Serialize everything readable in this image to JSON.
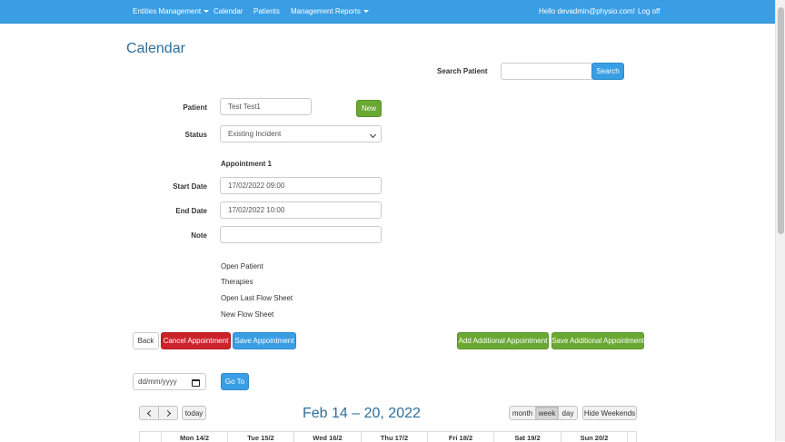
{
  "nav": {
    "entities": "Entities Management",
    "calendar": "Calendar",
    "patients": "Patients",
    "reports": "Management Reports",
    "greeting": "Hello devadmin@physio.com!",
    "logoff": "Log off"
  },
  "page": {
    "title": "Calendar"
  },
  "search": {
    "label": "Search Patient",
    "value": "",
    "button": "Search"
  },
  "form": {
    "patient_label": "Patient",
    "patient_value": "Test Test1",
    "new_button": "New",
    "status_label": "Status",
    "status_value": "Existing Incident",
    "appointment_heading": "Appointment 1",
    "start_label": "Start Date",
    "start_value": "17/02/2022 09:00",
    "end_label": "End Date",
    "end_value": "17/02/2022 10:00",
    "note_label": "Note",
    "note_value": ""
  },
  "links": [
    "Open Patient",
    "Therapies",
    "Open Last Flow Sheet",
    "New Flow Sheet"
  ],
  "actions": {
    "back": "Back",
    "cancel": "Cancel Appointment",
    "save": "Save Appointment",
    "add_additional": "Add Additional Appointment",
    "save_additional": "Save Additional Appointment"
  },
  "goto": {
    "date_placeholder": "dd/mm/yyyy",
    "button": "Go To"
  },
  "calendar": {
    "today": "today",
    "range_title": "Feb 14 – 20, 2022",
    "views": [
      "month",
      "week",
      "day"
    ],
    "active_view": "week",
    "hide_weekends": "Hide Weekends",
    "days": [
      "Mon 14/2",
      "Tue 15/2",
      "Wed 16/2",
      "Thu 17/2",
      "Fri 18/2",
      "Sat 19/2",
      "Sun 20/2"
    ]
  },
  "colors": {
    "navbar": "#3a9ee4",
    "primary": "#3a9ee4",
    "success": "#6aa834",
    "danger": "#cc2229",
    "title": "#2c6e9e"
  }
}
